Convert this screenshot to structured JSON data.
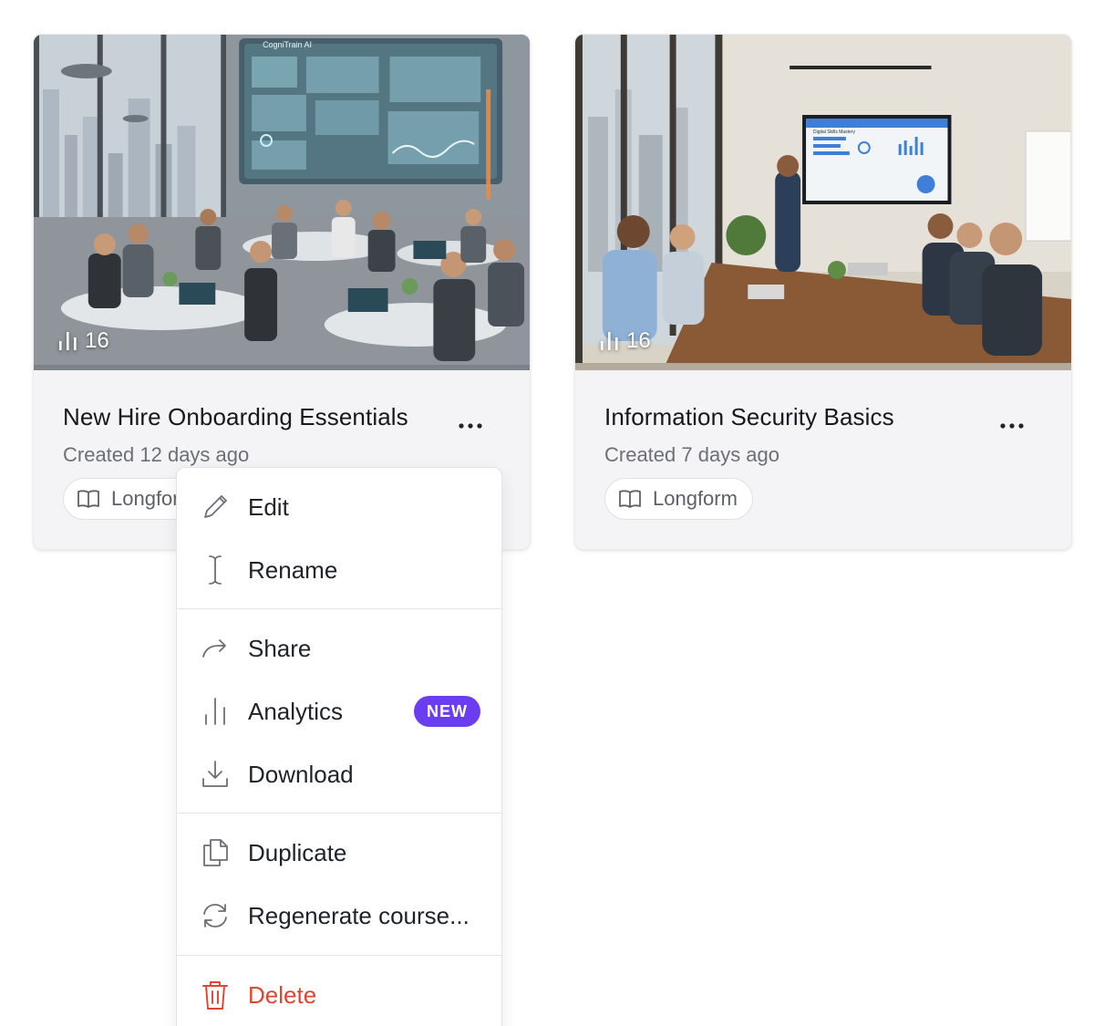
{
  "cards": [
    {
      "title": "New Hire Onboarding Essentials",
      "created": "Created 12 days ago",
      "count": "16",
      "format_label": "Longform",
      "image_text": "CogniTrain AI"
    },
    {
      "title": "Information Security Basics",
      "created": "Created 7 days ago",
      "count": "16",
      "format_label": "Longform",
      "image_text": "Digital Skills Mastery"
    }
  ],
  "menu": {
    "edit": "Edit",
    "rename": "Rename",
    "share": "Share",
    "analytics": "Analytics",
    "analytics_badge": "NEW",
    "download": "Download",
    "duplicate": "Duplicate",
    "regenerate": "Regenerate course...",
    "delete": "Delete"
  },
  "colors": {
    "accent_badge": "#6a3df0",
    "danger": "#e0452f",
    "card_bg": "#f4f4f6"
  },
  "icons": [
    "bar-chart-icon",
    "more-icon",
    "book-icon",
    "pencil-icon",
    "text-cursor-icon",
    "share-arrow-icon",
    "analytics-icon",
    "download-icon",
    "duplicate-icon",
    "refresh-icon",
    "trash-icon"
  ]
}
